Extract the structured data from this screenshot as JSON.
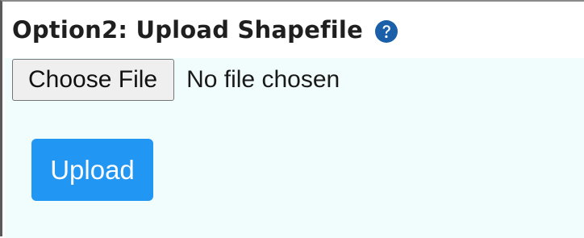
{
  "section": {
    "title": "Option2: Upload Shapefile",
    "help_icon": "question-circle-icon",
    "help_icon_color": "#1a5fa8"
  },
  "file_input": {
    "button_label": "Choose File",
    "status_text": "No file chosen"
  },
  "upload": {
    "label": "Upload",
    "color": "#2196f3"
  },
  "colors": {
    "panel_background": "#f1fcfd"
  }
}
